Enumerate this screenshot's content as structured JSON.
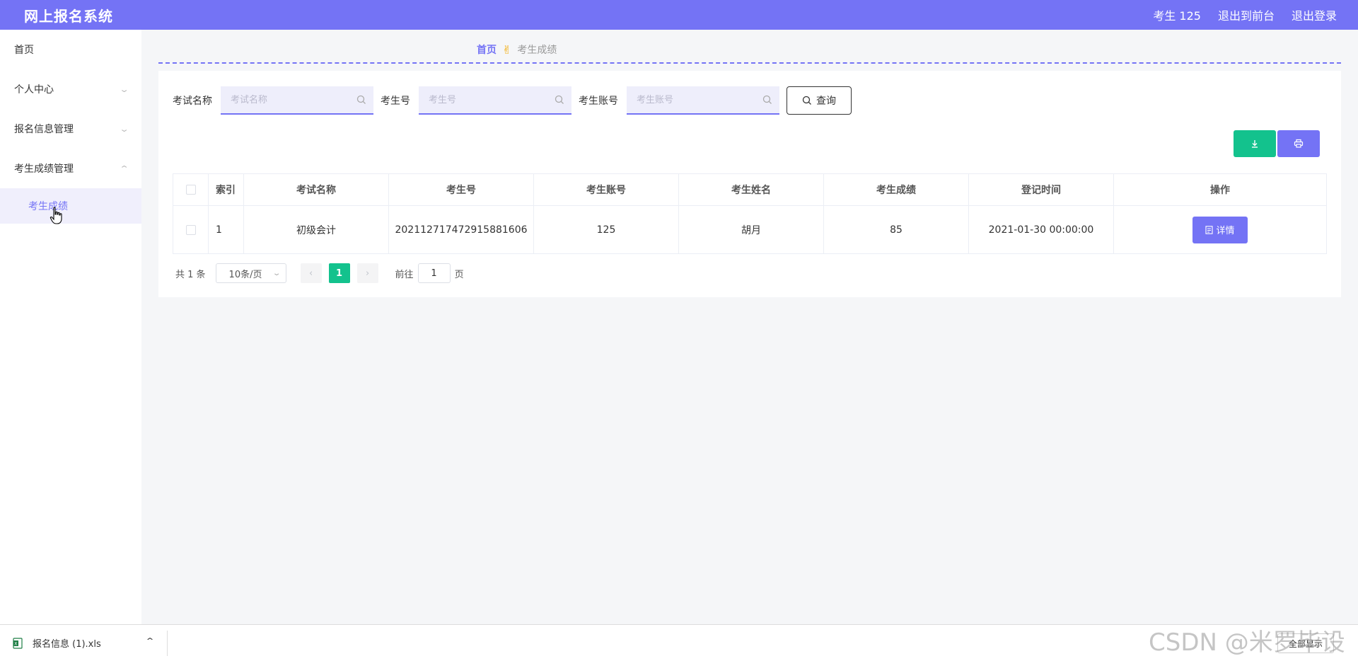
{
  "header": {
    "brand": "网上报名系统",
    "user": "考生 125",
    "to_frontend": "退出到前台",
    "logout": "退出登录"
  },
  "sidebar": {
    "items": [
      {
        "label": "首页"
      },
      {
        "label": "个人中心"
      },
      {
        "label": "报名信息管理"
      },
      {
        "label": "考生成绩管理"
      }
    ],
    "active_sub": "考生成绩"
  },
  "breadcrumb": {
    "home": "首页",
    "current": "考生成绩"
  },
  "search": {
    "exam_name_label": "考试名称",
    "exam_name_placeholder": "考试名称",
    "exam_no_label": "考生号",
    "exam_no_placeholder": "考生号",
    "account_label": "考生账号",
    "account_placeholder": "考生账号",
    "query_label": "查询"
  },
  "table": {
    "headers": [
      "索引",
      "考试名称",
      "考生号",
      "考生账号",
      "考生姓名",
      "考生成绩",
      "登记时间",
      "操作"
    ],
    "rows": [
      {
        "index": "1",
        "exam_name": "初级会计",
        "exam_no": "20211271747291588160­6",
        "account": "125",
        "name": "胡月",
        "score": "85",
        "time": "2021-01-30 00:00:00",
        "action": "详情"
      }
    ]
  },
  "pager": {
    "total": "共 1 条",
    "page_size": "10条/页",
    "current_page": "1",
    "goto_label": "前往",
    "goto_value": "1",
    "page_suffix": "页"
  },
  "downloads": {
    "file": "报名信息 (1).xls",
    "show_all": "全部显示"
  },
  "watermark": "CSDN @米罗毕设",
  "colors": {
    "accent": "#7473f5",
    "green": "#13c28d"
  }
}
